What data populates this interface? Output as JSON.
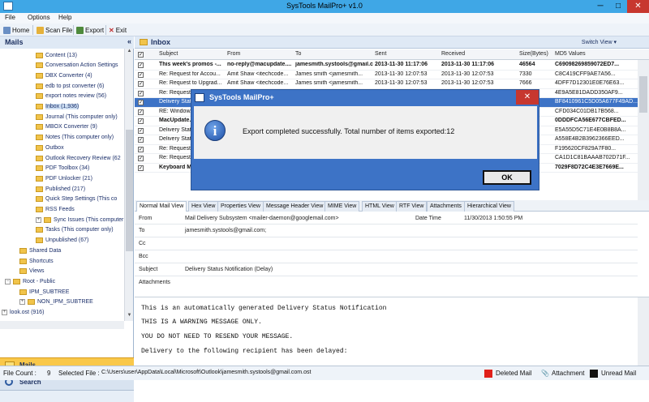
{
  "window": {
    "title": "SysTools MailPro+ v1.0",
    "min": "─",
    "max": "□",
    "close": "✕"
  },
  "menu": [
    "File",
    "Options",
    "Help"
  ],
  "toolbar": {
    "home": "Home",
    "scan": "Scan File",
    "export": "Export",
    "exit": "Exit"
  },
  "left": {
    "header": "Mails",
    "collapse": "«",
    "tree": [
      {
        "label": "Content (13)",
        "indent": 2
      },
      {
        "label": "Conversation Action Settings",
        "indent": 2
      },
      {
        "label": "DBX Converter (4)",
        "indent": 2
      },
      {
        "label": "edb to pst converter (6)",
        "indent": 2
      },
      {
        "label": "export notes review (56)",
        "indent": 2
      },
      {
        "label": "Inbox (1,936)",
        "indent": 2,
        "selected": true
      },
      {
        "label": "Journal (This computer only)",
        "indent": 2
      },
      {
        "label": "MBOX Converter (9)",
        "indent": 2
      },
      {
        "label": "Notes (This computer only)",
        "indent": 2
      },
      {
        "label": "Outbox",
        "indent": 2
      },
      {
        "label": "Outlook Recovery Review (62",
        "indent": 2
      },
      {
        "label": "PDF Toolbox (34)",
        "indent": 2
      },
      {
        "label": "PDF Unlocker (21)",
        "indent": 2
      },
      {
        "label": "Published (217)",
        "indent": 2
      },
      {
        "label": "Quick Step Settings (This co",
        "indent": 2
      },
      {
        "label": "RSS Feeds",
        "indent": 2
      },
      {
        "label": "Sync Issues (This computer or",
        "indent": 2,
        "expander": "+"
      },
      {
        "label": "Tasks (This computer only)",
        "indent": 2
      },
      {
        "label": "Unpublished (67)",
        "indent": 2
      },
      {
        "label": "Shared Data",
        "indent": 1
      },
      {
        "label": "Shortcuts",
        "indent": 1
      },
      {
        "label": "Views",
        "indent": 1
      },
      {
        "label": "Root - Public",
        "indent": 0,
        "expander": "−"
      },
      {
        "label": "IPM_SUBTREE",
        "indent": 1
      },
      {
        "label": "NON_IPM_SUBTREE",
        "indent": 1,
        "expander": "+"
      },
      {
        "label": "look.ost (916)",
        "indent": -1,
        "expander": "+"
      }
    ],
    "mails_btn": "Mails",
    "search_btn": "Search"
  },
  "inbox": {
    "title": "Inbox",
    "switch": "Switch View ▾",
    "columns": [
      "Subject",
      "From",
      "To",
      "Sent",
      "Received",
      "Size(Bytes)",
      "MD5 Values"
    ],
    "rows": [
      {
        "subject": "This week's promos -...",
        "from": "no-reply@macupdate....",
        "to": "jamesmith.systools@gmail.com",
        "sent": "2013-11-30 11:17:06",
        "received": "2013-11-30 11:17:06",
        "size": "46564",
        "md5": "C69098269859072ED7...",
        "bold": true
      },
      {
        "subject": "Re: Request for Accou...",
        "from": "Amit Shaw <itechcode...",
        "to": "James smith <jamesmith...",
        "sent": "2013-11-30 12:07:53",
        "received": "2013-11-30 12:07:53",
        "size": "7330",
        "md5": "C8C419CFF9AE7A56..."
      },
      {
        "subject": "Re: Request to Upgrad...",
        "from": "Amit Shaw <itechcode...",
        "to": "James smith <jamesmith...",
        "sent": "2013-11-30 12:07:53",
        "received": "2013-11-30 12:07:53",
        "size": "7666",
        "md5": "4DFF7D12301E0E76E63..."
      },
      {
        "subject": "Re: Request to...",
        "from": "",
        "to": "",
        "sent": "",
        "received": "",
        "size": "",
        "md5": "4E9A5E81DADD350AF9..."
      },
      {
        "subject": "Delivery Stat...",
        "from": "",
        "to": "",
        "sent": "",
        "received": "",
        "size": "",
        "md5": "BF8410961C5D05A677F49AD...",
        "selected": true
      },
      {
        "subject": "RE: Window...",
        "from": "",
        "to": "",
        "sent": "",
        "received": "",
        "size": "",
        "md5": "CFD034C01DB17B568..."
      },
      {
        "subject": "MacUpdate...",
        "from": "",
        "to": "",
        "sent": "",
        "received": "",
        "size": "",
        "md5": "0DDDFCA56E677CBFED...",
        "bold": true
      },
      {
        "subject": "Delivery Stat...",
        "from": "",
        "to": "",
        "sent": "",
        "received": "",
        "size": "",
        "md5": "E5A55D5C71E4E0B8B8A..."
      },
      {
        "subject": "Delivery Stat...",
        "from": "",
        "to": "",
        "sent": "",
        "received": "",
        "size": "",
        "md5": "A558E4B2B3962366EED..."
      },
      {
        "subject": "Re: Request...",
        "from": "",
        "to": "",
        "sent": "",
        "received": "",
        "size": "",
        "md5": "F195620CF829A7F80..."
      },
      {
        "subject": "Re: Request...",
        "from": "",
        "to": "",
        "sent": "",
        "received": "",
        "size": "",
        "md5": "CA1D1C81BAAAB702D71F..."
      },
      {
        "subject": "Keyboard M...",
        "from": "",
        "to": "",
        "sent": "",
        "received": "",
        "size": "",
        "md5": "7029F8D72C4E3E7669E...",
        "bold": true
      }
    ]
  },
  "tabs": [
    "Normal Mail View",
    "Hex View",
    "Properties View",
    "Message Header View",
    "MIME View",
    "HTML View",
    "RTF View",
    "Attachments",
    "Hierarchical View"
  ],
  "headers": {
    "from_label": "From",
    "from_value": "Mail Delivery Subsystem <mailer-daemon@googlemail.com>",
    "date_label": "Date Time",
    "date_value": "11/30/2013 1:50:55 PM",
    "to_label": "To",
    "to_value": "jamesmith.systools@gmail.com;",
    "cc_label": "Cc",
    "cc_value": "",
    "bcc_label": "Bcc",
    "bcc_value": "",
    "subject_label": "Subject",
    "subject_value": "Delivery Status Notification (Delay)",
    "attachments_label": "Attachments",
    "attachments_value": ""
  },
  "body_lines": [
    "This is an automatically generated Delivery Status Notification",
    "THIS IS A WARNING MESSAGE ONLY.",
    "YOU DO NOT NEED TO RESEND YOUR MESSAGE.",
    "Delivery to the following recipient has been delayed:"
  ],
  "status": {
    "file_count_label": "File Count :",
    "file_count": "9",
    "selected_label": "Selected File :",
    "selected_path": "C:\\Users\\user\\AppData\\Local\\Microsoft\\Outlook\\jamesmith.systools@gmail.com.ost",
    "deleted": "Deleted Mail",
    "attachment": "Attachment",
    "unread": "Unread Mail",
    "deleted_color": "#e0201a",
    "unread_color": "#111111"
  },
  "dialog": {
    "title": "SysTools MailPro+",
    "close": "✕",
    "message": "Export completed successfully. Total number of items exported:12",
    "ok": "OK"
  }
}
